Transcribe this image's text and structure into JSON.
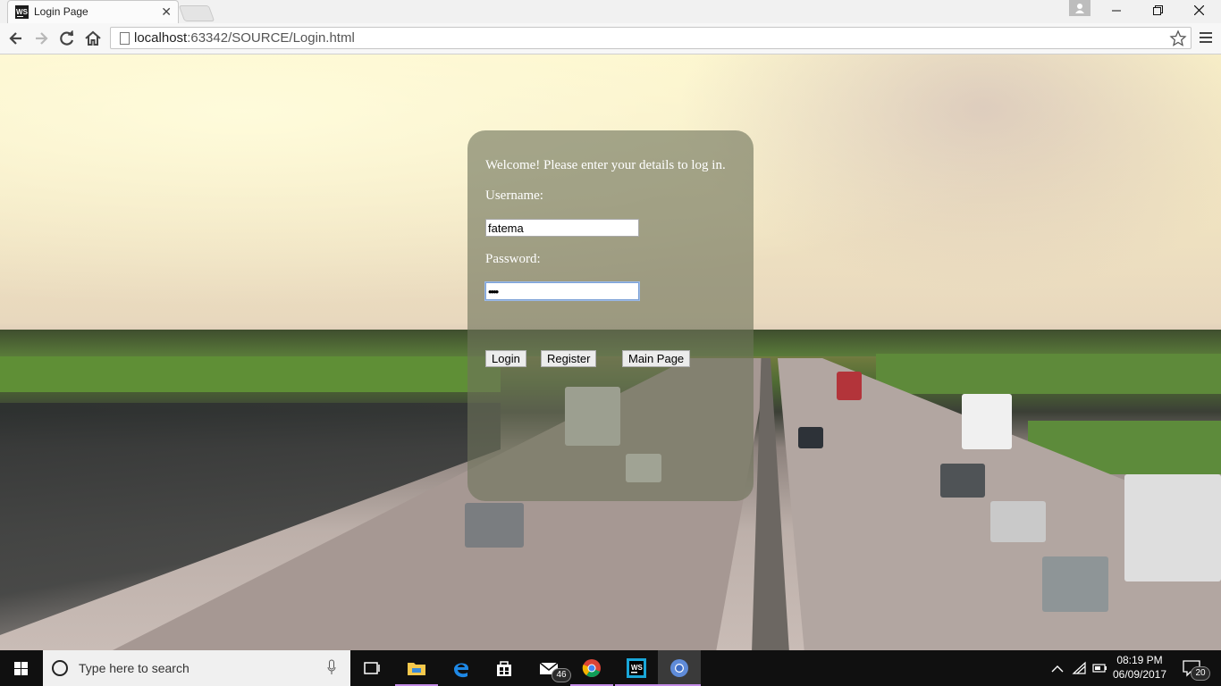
{
  "browser": {
    "tab_title": "Login Page",
    "tab_favicon_text": "WS",
    "close_glyph": "✕",
    "url_host": "localhost",
    "url_path": ":63342/SOURCE/Login.html"
  },
  "window_controls": {
    "minimize": "minimize-icon",
    "restore": "restore-icon",
    "close": "close-icon"
  },
  "login": {
    "welcome": "Welcome! Please enter your details to log in.",
    "username_label": "Username:",
    "username_value": "fatema",
    "password_label": "Password:",
    "password_value": "••••",
    "buttons": {
      "login": "Login",
      "register": "Register",
      "main_page": "Main Page"
    }
  },
  "taskbar": {
    "search_placeholder": "Type here to search",
    "mail_badge": "46",
    "time": "08:19 PM",
    "date": "06/09/2017",
    "notification_count": "20",
    "pinned": [
      "task-view-icon",
      "file-explorer-icon",
      "edge-icon",
      "store-icon",
      "mail-icon",
      "chrome-icon",
      "webstorm-icon",
      "chrome-canary-icon"
    ]
  },
  "colors": {
    "panel_bg": "#6e735a",
    "taskbar_bg": "#101010",
    "accent_underline": "#c38be6"
  }
}
